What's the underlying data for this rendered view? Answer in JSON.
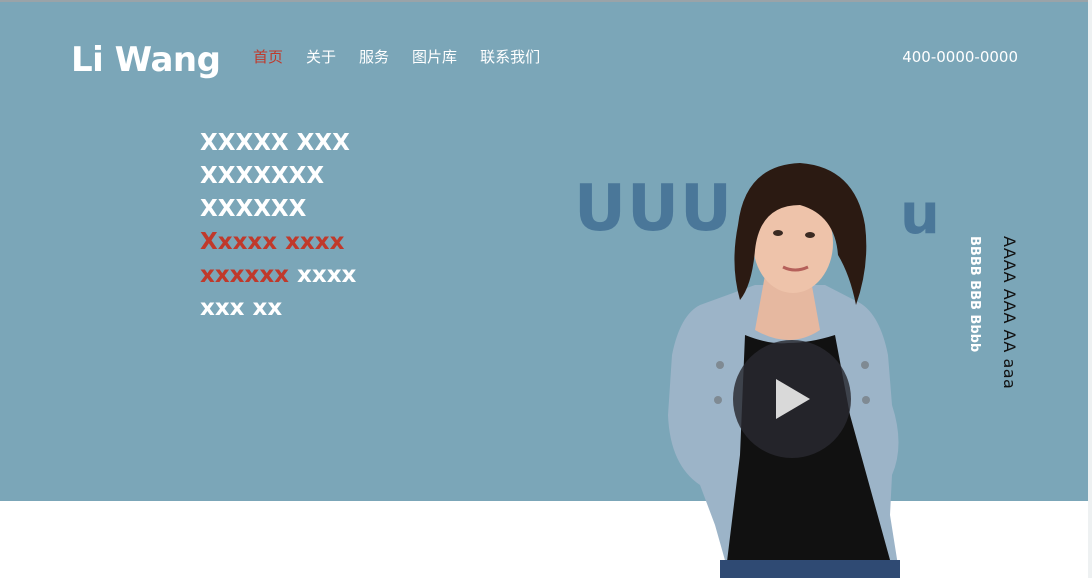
{
  "header": {
    "logo": "Li Wang",
    "phone": "400-0000-0000",
    "nav": [
      {
        "label": "首页",
        "active": true
      },
      {
        "label": "关于",
        "active": false
      },
      {
        "label": "服务",
        "active": false
      },
      {
        "label": "图片库",
        "active": false
      },
      {
        "label": "联系我们",
        "active": false
      }
    ]
  },
  "hero": {
    "background_color": "#7ba6b8",
    "accent_color": "#c0392b",
    "headline": {
      "line1": "XXXXX XXX",
      "line2": "XXXXXXX",
      "line3": "XXXXXX",
      "line4": "Xxxxx xxxx",
      "line5_red": "xxxxxx",
      "line5_white": " xxxx",
      "line6": "xxx xx"
    },
    "big_text_left": "UUU",
    "big_text_right": "u",
    "vertical_text_a": "AAAA AAA AA aaa",
    "vertical_text_b": "BBBB BBB Bbbb",
    "video_button_icon": "play-icon"
  }
}
